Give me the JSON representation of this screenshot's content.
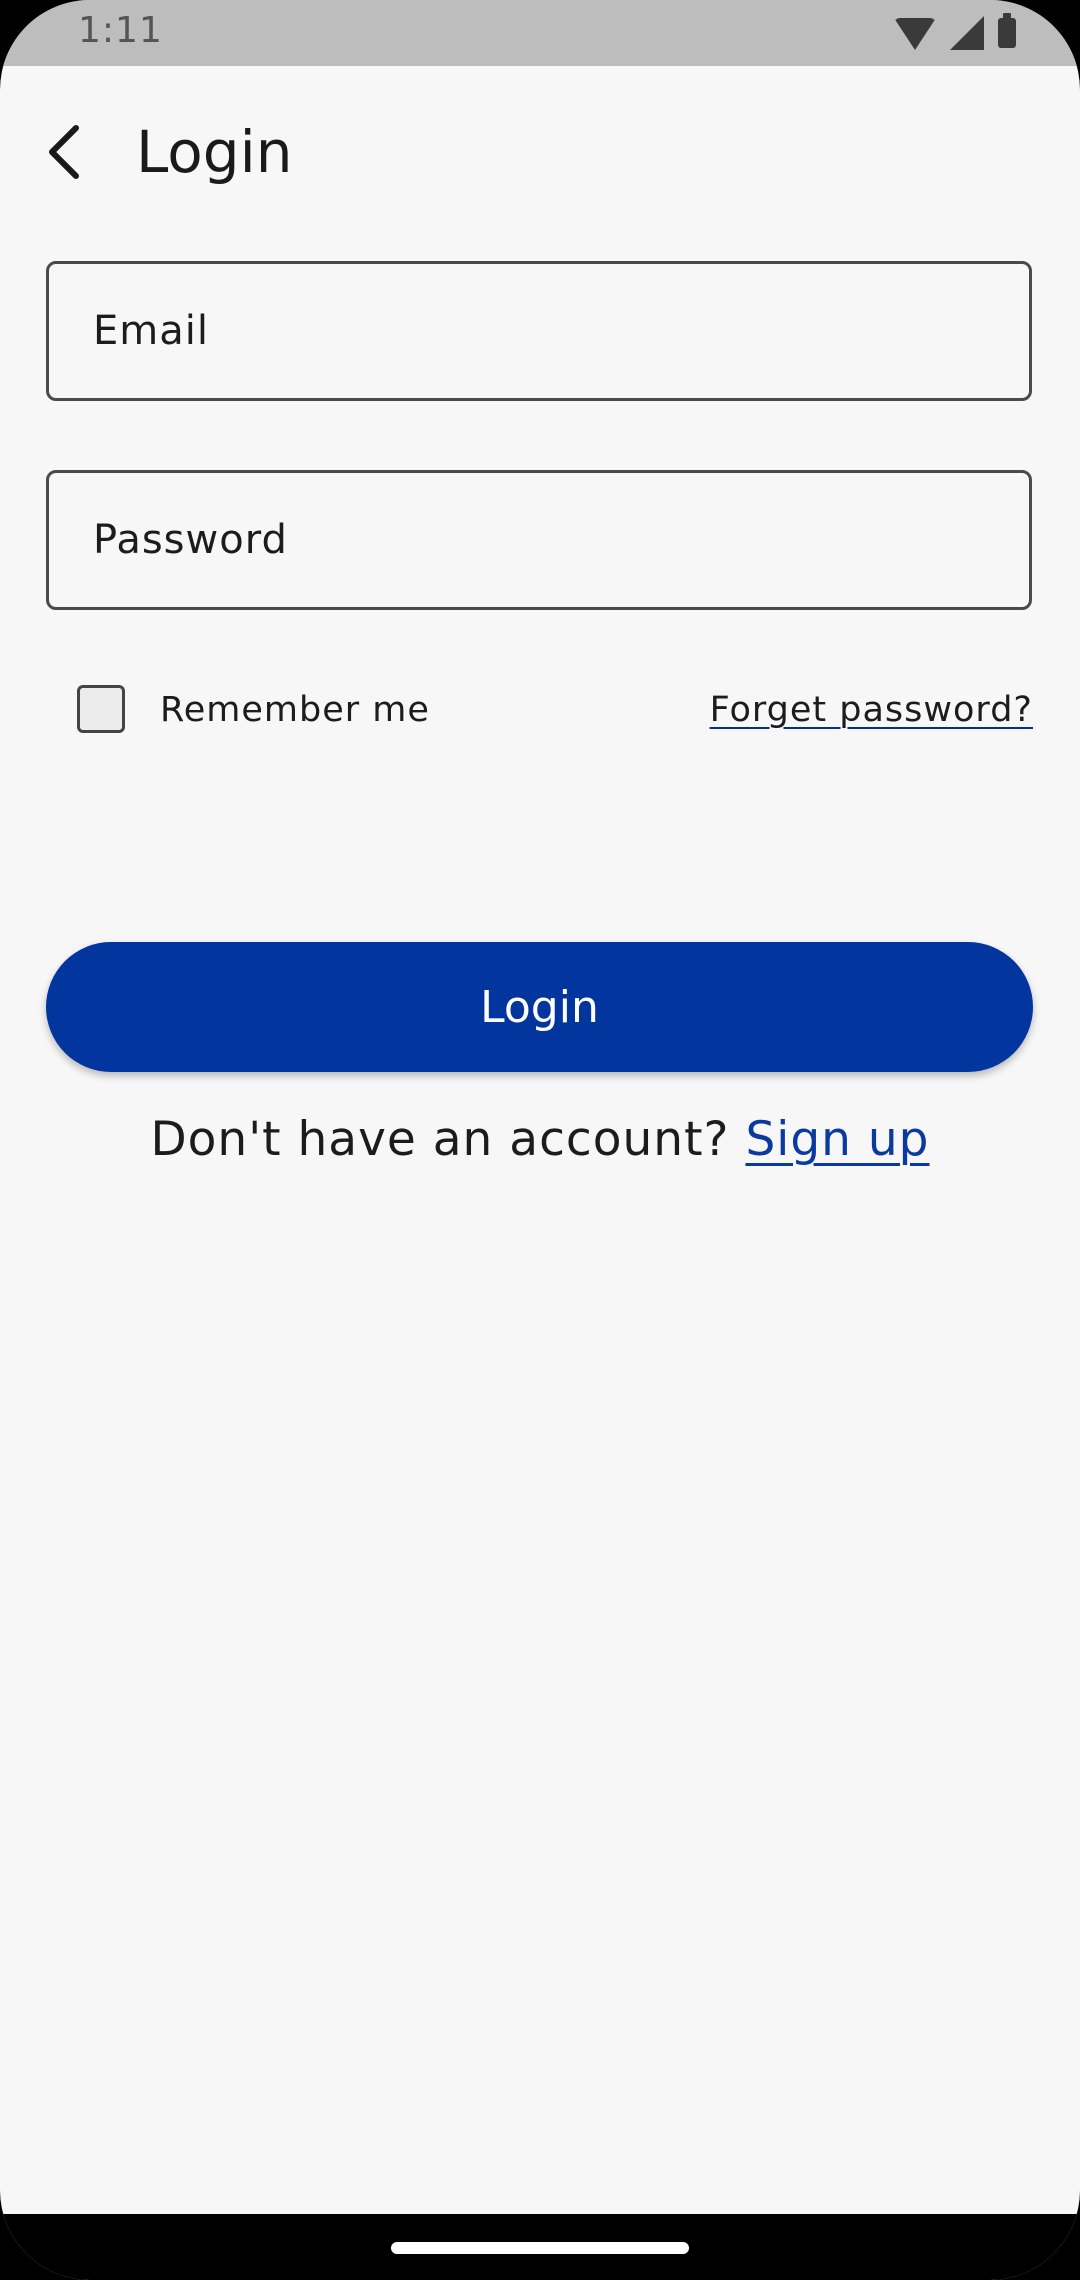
{
  "status_bar": {
    "time": "1:11"
  },
  "app_bar": {
    "title": "Login",
    "back_icon": "chevron-left-icon"
  },
  "form": {
    "email_placeholder": "Email",
    "email_value": "",
    "password_placeholder": "Password",
    "password_value": "",
    "remember_label": "Remember me",
    "remember_checked": false,
    "forgot_link": "Forget password?",
    "login_button": "Login"
  },
  "signup": {
    "prompt": "Don't have an account?",
    "link": "Sign up"
  },
  "colors": {
    "primary": "#02359e",
    "link": "#0a3aa0",
    "background": "#f7f7f8",
    "status_bar": "#bdbdbd"
  }
}
